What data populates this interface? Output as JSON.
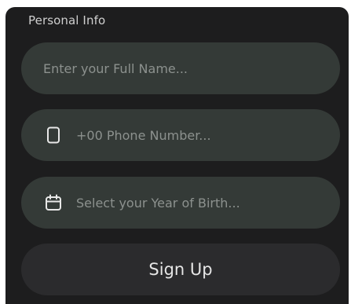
{
  "form": {
    "section_title": "Personal Info",
    "full_name": {
      "placeholder": "Enter your Full Name...",
      "value": ""
    },
    "phone": {
      "icon": "phone-icon",
      "placeholder": "+00 Phone Number...",
      "value": ""
    },
    "birth_year": {
      "icon": "calendar-icon",
      "placeholder": "Select your Year of Birth...",
      "value": ""
    },
    "submit_label": "Sign Up"
  },
  "colors": {
    "card_background": "#1d1d1e",
    "field_background": "#343a37",
    "button_background": "#2b2b2d",
    "placeholder_text": "#8c918e",
    "title_text": "#cfcfcf",
    "button_text": "#e6e6e6"
  }
}
